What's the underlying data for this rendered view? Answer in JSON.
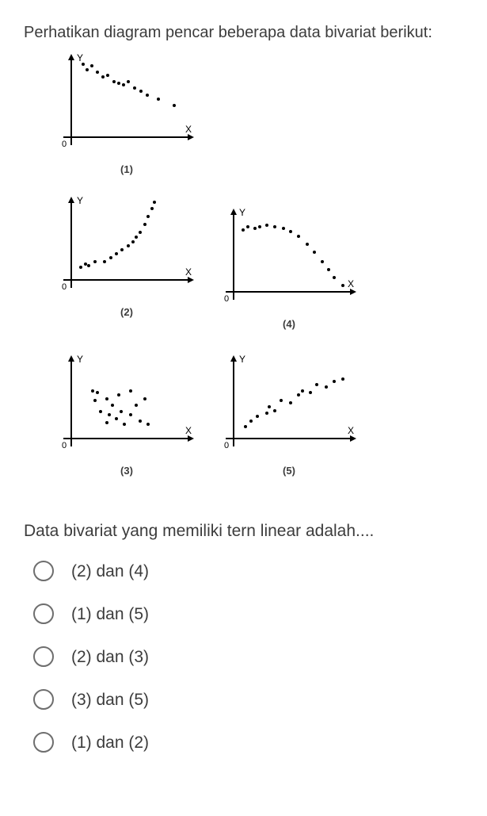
{
  "intro": "Perhatikan diagram pencar beberapa data bivariat berikut:",
  "question_text": "Data bivariat yang memiliki tern linear adalah....",
  "charts": {
    "c1_label": "(1)",
    "c2_label": "(2)",
    "c3_label": "(3)",
    "c4_label": "(4)",
    "c5_label": "(5)"
  },
  "options": {
    "a": "(2) dan (4)",
    "b": "(1) dan (5)",
    "c": "(2) dan (3)",
    "d": "(3) dan (5)",
    "e": "(1) dan (2)"
  },
  "chart_data": [
    {
      "id": 1,
      "type": "scatter",
      "xlabel": "X",
      "ylabel": "Y",
      "points": [
        {
          "x": 0.1,
          "y": 0.95
        },
        {
          "x": 0.14,
          "y": 0.88
        },
        {
          "x": 0.2,
          "y": 0.92
        },
        {
          "x": 0.25,
          "y": 0.85
        },
        {
          "x": 0.3,
          "y": 0.78
        },
        {
          "x": 0.35,
          "y": 0.8
        },
        {
          "x": 0.4,
          "y": 0.72
        },
        {
          "x": 0.45,
          "y": 0.7
        },
        {
          "x": 0.5,
          "y": 0.68
        },
        {
          "x": 0.55,
          "y": 0.72
        },
        {
          "x": 0.6,
          "y": 0.65
        },
        {
          "x": 0.65,
          "y": 0.6
        },
        {
          "x": 0.7,
          "y": 0.55
        },
        {
          "x": 0.8,
          "y": 0.5
        },
        {
          "x": 0.93,
          "y": 0.42
        }
      ],
      "pattern": "negative-linear"
    },
    {
      "id": 2,
      "type": "scatter",
      "xlabel": "X",
      "ylabel": "Y",
      "points": [
        {
          "x": 0.08,
          "y": 0.18
        },
        {
          "x": 0.12,
          "y": 0.22
        },
        {
          "x": 0.15,
          "y": 0.2
        },
        {
          "x": 0.2,
          "y": 0.25
        },
        {
          "x": 0.28,
          "y": 0.25
        },
        {
          "x": 0.33,
          "y": 0.3
        },
        {
          "x": 0.38,
          "y": 0.35
        },
        {
          "x": 0.43,
          "y": 0.4
        },
        {
          "x": 0.48,
          "y": 0.45
        },
        {
          "x": 0.52,
          "y": 0.5
        },
        {
          "x": 0.55,
          "y": 0.55
        },
        {
          "x": 0.58,
          "y": 0.6
        },
        {
          "x": 0.62,
          "y": 0.7
        },
        {
          "x": 0.65,
          "y": 0.8
        },
        {
          "x": 0.68,
          "y": 0.9
        },
        {
          "x": 0.7,
          "y": 0.98
        }
      ],
      "pattern": "increasing-curved"
    },
    {
      "id": 3,
      "type": "scatter",
      "xlabel": "X",
      "ylabel": "Y",
      "points": [
        {
          "x": 0.18,
          "y": 0.6
        },
        {
          "x": 0.2,
          "y": 0.48
        },
        {
          "x": 0.22,
          "y": 0.58
        },
        {
          "x": 0.25,
          "y": 0.35
        },
        {
          "x": 0.3,
          "y": 0.5
        },
        {
          "x": 0.3,
          "y": 0.2
        },
        {
          "x": 0.32,
          "y": 0.3
        },
        {
          "x": 0.35,
          "y": 0.42
        },
        {
          "x": 0.38,
          "y": 0.25
        },
        {
          "x": 0.4,
          "y": 0.55
        },
        {
          "x": 0.42,
          "y": 0.35
        },
        {
          "x": 0.45,
          "y": 0.18
        },
        {
          "x": 0.5,
          "y": 0.6
        },
        {
          "x": 0.5,
          "y": 0.3
        },
        {
          "x": 0.55,
          "y": 0.42
        },
        {
          "x": 0.58,
          "y": 0.22
        },
        {
          "x": 0.62,
          "y": 0.5
        },
        {
          "x": 0.65,
          "y": 0.18
        }
      ],
      "pattern": "random"
    },
    {
      "id": 4,
      "type": "scatter",
      "xlabel": "X",
      "ylabel": "Y",
      "points": [
        {
          "x": 0.08,
          "y": 0.78
        },
        {
          "x": 0.12,
          "y": 0.82
        },
        {
          "x": 0.18,
          "y": 0.8
        },
        {
          "x": 0.22,
          "y": 0.82
        },
        {
          "x": 0.28,
          "y": 0.84
        },
        {
          "x": 0.35,
          "y": 0.82
        },
        {
          "x": 0.42,
          "y": 0.8
        },
        {
          "x": 0.48,
          "y": 0.76
        },
        {
          "x": 0.55,
          "y": 0.7
        },
        {
          "x": 0.62,
          "y": 0.6
        },
        {
          "x": 0.68,
          "y": 0.5
        },
        {
          "x": 0.75,
          "y": 0.38
        },
        {
          "x": 0.8,
          "y": 0.28
        },
        {
          "x": 0.85,
          "y": 0.18
        },
        {
          "x": 0.92,
          "y": 0.08
        }
      ],
      "pattern": "curved-decreasing"
    },
    {
      "id": 5,
      "type": "scatter",
      "xlabel": "X",
      "ylabel": "Y",
      "points": [
        {
          "x": 0.1,
          "y": 0.15
        },
        {
          "x": 0.15,
          "y": 0.22
        },
        {
          "x": 0.2,
          "y": 0.28
        },
        {
          "x": 0.28,
          "y": 0.32
        },
        {
          "x": 0.3,
          "y": 0.4
        },
        {
          "x": 0.35,
          "y": 0.35
        },
        {
          "x": 0.4,
          "y": 0.48
        },
        {
          "x": 0.48,
          "y": 0.45
        },
        {
          "x": 0.55,
          "y": 0.55
        },
        {
          "x": 0.58,
          "y": 0.6
        },
        {
          "x": 0.65,
          "y": 0.58
        },
        {
          "x": 0.7,
          "y": 0.68
        },
        {
          "x": 0.78,
          "y": 0.65
        },
        {
          "x": 0.85,
          "y": 0.72
        },
        {
          "x": 0.92,
          "y": 0.75
        }
      ],
      "pattern": "positive-linear"
    }
  ]
}
